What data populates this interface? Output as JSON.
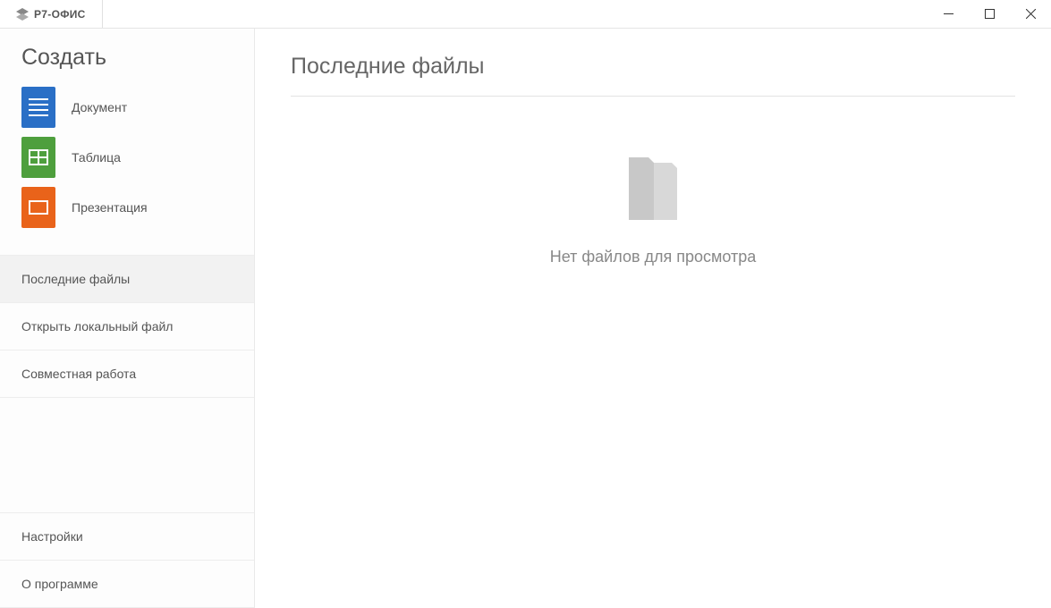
{
  "app": {
    "name": "Р7-ОФИС"
  },
  "sidebar": {
    "create_heading": "Создать",
    "create_items": [
      {
        "label": "Документ"
      },
      {
        "label": "Таблица"
      },
      {
        "label": "Презентация"
      }
    ],
    "nav_items": [
      {
        "label": "Последние файлы",
        "active": true
      },
      {
        "label": "Открыть локальный файл",
        "active": false
      },
      {
        "label": "Совместная работа",
        "active": false
      }
    ],
    "bottom_items": [
      {
        "label": "Настройки"
      },
      {
        "label": "О программе"
      }
    ]
  },
  "main": {
    "title": "Последние файлы",
    "empty_message": "Нет файлов для просмотра"
  }
}
